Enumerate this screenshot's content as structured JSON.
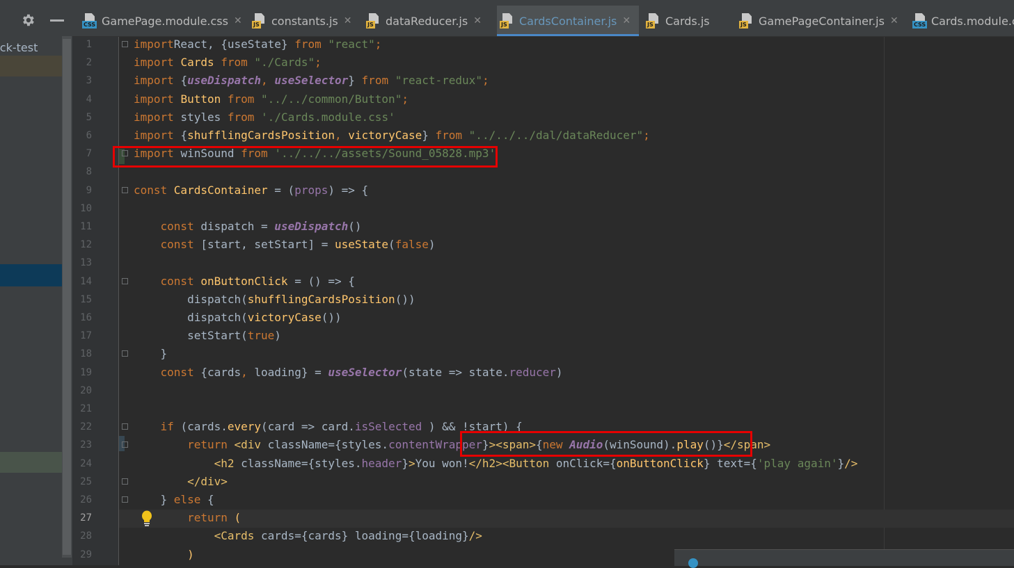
{
  "project_panel": {
    "project_label": "ack-test"
  },
  "tabs": [
    {
      "name": "GamePage.module.css",
      "type": "CSS",
      "active": false,
      "closable": true
    },
    {
      "name": "constants.js",
      "type": "JS",
      "active": false,
      "closable": true
    },
    {
      "name": "dataReducer.js",
      "type": "JS",
      "active": false,
      "closable": true
    },
    {
      "name": "CardsContainer.js",
      "type": "JS",
      "active": true,
      "closable": true
    },
    {
      "name": "Cards.js",
      "type": "JS",
      "active": false,
      "closable": false
    },
    {
      "name": "GamePageContainer.js",
      "type": "JS",
      "active": false,
      "closable": true
    },
    {
      "name": "Cards.module.cs",
      "type": "CSS",
      "active": false,
      "closable": false
    }
  ],
  "editor": {
    "current_line": 27,
    "lines": [
      {
        "n": "1",
        "tokens": [
          [
            "kw",
            "import"
          ],
          [
            "",
            "React, {useState} "
          ],
          [
            "kw",
            "from"
          ],
          [
            "",
            ""
          ],
          [
            "str",
            " \"react\""
          ],
          [
            "kw",
            ";"
          ]
        ]
      },
      {
        "n": "2",
        "tokens": [
          [
            "kw",
            "import "
          ],
          [
            "fn",
            "Cards"
          ],
          [
            "kw",
            " from "
          ],
          [
            "str",
            "\"./Cards\""
          ],
          [
            "kw",
            ";"
          ]
        ]
      },
      {
        "n": "3",
        "tokens": [
          [
            "kw",
            "import "
          ],
          [
            "",
            "{"
          ],
          [
            "hook",
            "useDispatch"
          ],
          [
            "kw",
            ", "
          ],
          [
            "hook",
            "useSelector"
          ],
          [
            "",
            "} "
          ],
          [
            "kw",
            "from "
          ],
          [
            "str",
            "\"react-redux\""
          ],
          [
            "kw",
            ";"
          ]
        ]
      },
      {
        "n": "4",
        "tokens": [
          [
            "kw",
            "import "
          ],
          [
            "fn",
            "Button"
          ],
          [
            "kw",
            " from "
          ],
          [
            "str",
            "\"../../common/Button\""
          ],
          [
            "kw",
            ";"
          ]
        ]
      },
      {
        "n": "5",
        "tokens": [
          [
            "kw",
            "import "
          ],
          [
            "",
            "styles "
          ],
          [
            "kw",
            "from "
          ],
          [
            "str",
            "'./Cards.module.css'"
          ]
        ]
      },
      {
        "n": "6",
        "tokens": [
          [
            "kw",
            "import "
          ],
          [
            "",
            "{"
          ],
          [
            "fn",
            "shufflingCardsPosition"
          ],
          [
            "kw",
            ", "
          ],
          [
            "fn",
            "victoryCase"
          ],
          [
            "",
            "} "
          ],
          [
            "kw",
            "from "
          ],
          [
            "str",
            "\"../../../dal/dataReducer\""
          ],
          [
            "kw",
            ";"
          ]
        ]
      },
      {
        "n": "7",
        "tokens": [
          [
            "kw",
            "import "
          ],
          [
            "",
            "winSound "
          ],
          [
            "kw",
            "from "
          ],
          [
            "str",
            "'../../../assets/Sound_05828.mp3'"
          ]
        ]
      },
      {
        "n": "8",
        "tokens": []
      },
      {
        "n": "9",
        "tokens": [
          [
            "kw",
            "const "
          ],
          [
            "fn",
            "CardsContainer"
          ],
          [
            "",
            " = ("
          ],
          [
            "prop",
            "props"
          ],
          [
            "",
            ") => {"
          ]
        ]
      },
      {
        "n": "10",
        "tokens": []
      },
      {
        "n": "11",
        "tokens": [
          [
            "",
            "    "
          ],
          [
            "kw",
            "const "
          ],
          [
            "",
            "dispatch = "
          ],
          [
            "hook",
            "useDispatch"
          ],
          [
            "",
            "()"
          ]
        ]
      },
      {
        "n": "12",
        "tokens": [
          [
            "",
            "    "
          ],
          [
            "kw",
            "const "
          ],
          [
            "",
            "[start, setStart] = "
          ],
          [
            "fn",
            "useState"
          ],
          [
            "",
            "("
          ],
          [
            "kw",
            "false"
          ],
          [
            "",
            ")"
          ]
        ]
      },
      {
        "n": "13",
        "tokens": []
      },
      {
        "n": "14",
        "tokens": [
          [
            "",
            "    "
          ],
          [
            "kw",
            "const "
          ],
          [
            "fn",
            "onButtonClick"
          ],
          [
            "",
            " = () => {"
          ]
        ]
      },
      {
        "n": "15",
        "tokens": [
          [
            "",
            "        dispatch("
          ],
          [
            "fn",
            "shufflingCardsPosition"
          ],
          [
            "",
            "())"
          ]
        ]
      },
      {
        "n": "16",
        "tokens": [
          [
            "",
            "        dispatch("
          ],
          [
            "fn",
            "victoryCase"
          ],
          [
            "",
            "())"
          ]
        ]
      },
      {
        "n": "17",
        "tokens": [
          [
            "",
            "        setStart("
          ],
          [
            "kw",
            "true"
          ],
          [
            "",
            ")"
          ]
        ]
      },
      {
        "n": "18",
        "tokens": [
          [
            "",
            "    }"
          ]
        ]
      },
      {
        "n": "19",
        "tokens": [
          [
            "",
            "    "
          ],
          [
            "kw",
            "const "
          ],
          [
            "",
            "{cards"
          ],
          [
            "kw",
            ", "
          ],
          [
            "",
            "loading} = "
          ],
          [
            "hook",
            "useSelector"
          ],
          [
            "",
            "(state => state."
          ],
          [
            "prop",
            "reducer"
          ],
          [
            "",
            ")"
          ]
        ]
      },
      {
        "n": "20",
        "tokens": []
      },
      {
        "n": "21",
        "tokens": []
      },
      {
        "n": "22",
        "tokens": [
          [
            "",
            "    "
          ],
          [
            "kw",
            "if "
          ],
          [
            "",
            "(cards."
          ],
          [
            "fn",
            "every"
          ],
          [
            "",
            "(card => card."
          ],
          [
            "prop",
            "isSelected"
          ],
          [
            "",
            " ) && !start) {"
          ]
        ]
      },
      {
        "n": "23",
        "tokens": [
          [
            "",
            "        "
          ],
          [
            "kw",
            "return "
          ],
          [
            "tag",
            "<div "
          ],
          [
            "",
            "className={styles."
          ],
          [
            "prop",
            "contentWrapper"
          ],
          [
            "",
            "}"
          ],
          [
            "tag",
            "><span>"
          ],
          [
            "",
            "{"
          ],
          [
            "kw",
            "new "
          ],
          [
            "hook",
            "Audio"
          ],
          [
            "",
            "(winSound)."
          ],
          [
            "fn",
            "play"
          ],
          [
            "",
            "()}"
          ],
          [
            "tag",
            "</span>"
          ]
        ]
      },
      {
        "n": "24",
        "tokens": [
          [
            "",
            "            "
          ],
          [
            "tag",
            "<h2 "
          ],
          [
            "",
            "className={styles."
          ],
          [
            "prop",
            "header"
          ],
          [
            "",
            "}"
          ],
          [
            "tag",
            ">"
          ],
          [
            "",
            "You won!"
          ],
          [
            "tag",
            "</h2><Button "
          ],
          [
            "",
            "onClick={"
          ],
          [
            "fn",
            "onButtonClick"
          ],
          [
            "",
            "} text={"
          ],
          [
            "str",
            "'play again'"
          ],
          [
            "",
            "}"
          ],
          [
            "tag",
            "/>"
          ]
        ]
      },
      {
        "n": "25",
        "tokens": [
          [
            "",
            "        "
          ],
          [
            "tag",
            "</div>"
          ]
        ]
      },
      {
        "n": "26",
        "tokens": [
          [
            "",
            "    } "
          ],
          [
            "kw",
            "else "
          ],
          [
            "",
            "{"
          ]
        ]
      },
      {
        "n": "27",
        "tokens": [
          [
            "",
            "        "
          ],
          [
            "kw",
            "return "
          ],
          [
            "fn",
            "("
          ]
        ]
      },
      {
        "n": "28",
        "tokens": [
          [
            "",
            "            "
          ],
          [
            "tag",
            "<Cards "
          ],
          [
            "",
            "cards={cards} loading={loading}"
          ],
          [
            "tag",
            "/>"
          ]
        ]
      },
      {
        "n": "29",
        "tokens": [
          [
            "",
            "        "
          ],
          [
            "fn",
            ")"
          ]
        ]
      }
    ]
  }
}
